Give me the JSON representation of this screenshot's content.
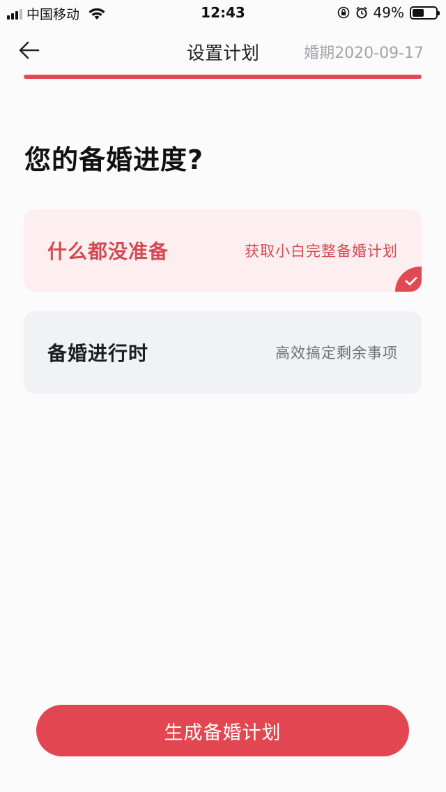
{
  "status_bar": {
    "carrier": "中国移动",
    "time": "12:43",
    "battery_percent": "49%",
    "battery_level": 0.49
  },
  "nav": {
    "title": "设置计划",
    "wedding_date": "婚期2020-09-17"
  },
  "progress": {
    "fraction": 1.0,
    "color": "#e04a53"
  },
  "question": "您的备婚进度?",
  "options": [
    {
      "title": "什么都没准备",
      "subtitle": "获取小白完整备婚计划",
      "selected": true
    },
    {
      "title": "备婚进行时",
      "subtitle": "高效搞定剩余事项",
      "selected": false
    }
  ],
  "submit_label": "生成备婚计划",
  "colors": {
    "accent": "#e24650",
    "selected_bg": "#fdeff0",
    "option_bg": "#f1f2f6"
  },
  "icons": [
    "signal-icon",
    "wifi-icon",
    "lock-rotation-icon",
    "alarm-icon",
    "battery-icon",
    "back-arrow-icon",
    "checkmark-icon"
  ]
}
